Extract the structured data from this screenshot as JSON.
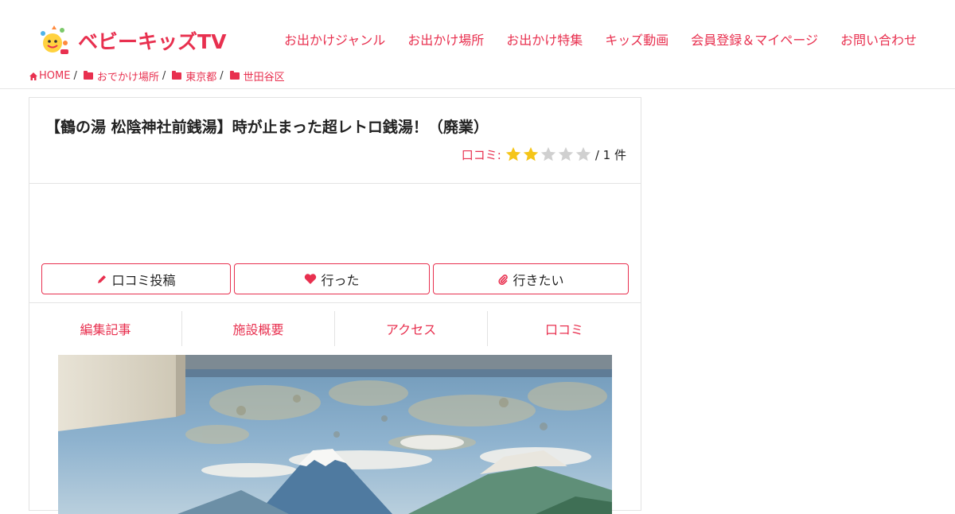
{
  "brand": {
    "name_kana": "ベビーキッズ",
    "name_suffix": "TV",
    "color": "#e8304f"
  },
  "gnav": [
    {
      "label": "お出かけジャンル"
    },
    {
      "label": "お出かけ場所"
    },
    {
      "label": "お出かけ特集"
    },
    {
      "label": "キッズ動画"
    },
    {
      "label": "会員登録＆マイページ"
    },
    {
      "label": "お問い合わせ"
    }
  ],
  "breadcrumb": {
    "home": "HOME",
    "items": [
      "おでかけ場所",
      "東京都",
      "世田谷区"
    ],
    "separator": "/"
  },
  "article": {
    "title": "【鶴の湯 松陰神社前銭湯】時が止まった超レトロ銭湯！（廃業）",
    "rating_label": "口コミ:",
    "rating_value": 2,
    "rating_max": 5,
    "rating_count": "/ 1 件"
  },
  "actions": {
    "review": "口コミ投稿",
    "went": "行った",
    "want": "行きたい"
  },
  "tabs": [
    "編集記事",
    "施設概要",
    "アクセス",
    "口コミ"
  ],
  "photo": {
    "subject": "bathhouse-mural-mount-fuji"
  }
}
